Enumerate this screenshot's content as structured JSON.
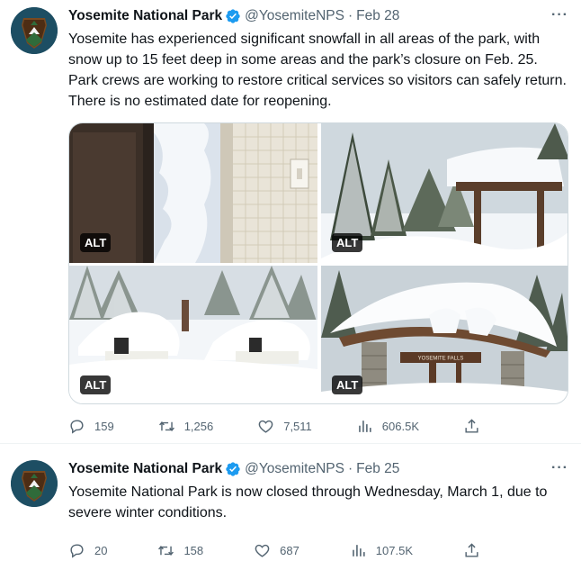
{
  "tweets": [
    {
      "name": "Yosemite National Park",
      "handle": "@YosemiteNPS",
      "separator": "·",
      "date": "Feb 28",
      "more": "···",
      "text": "Yosemite has experienced significant snowfall in all areas of the park, with snow up to 15 feet deep in some areas and the park’s closure on Feb. 25. Park crews are working to restore critical services so visitors can safely return. There is no estimated date for reopening.",
      "media": [
        {
          "alt_badge": "ALT",
          "sign": ""
        },
        {
          "alt_badge": "ALT",
          "sign": ""
        },
        {
          "alt_badge": "ALT",
          "sign": ""
        },
        {
          "alt_badge": "ALT",
          "sign": "YOSEMITE FALLS"
        }
      ],
      "replies": "159",
      "retweets": "1,256",
      "likes": "7,511",
      "views": "606.5K"
    },
    {
      "name": "Yosemite National Park",
      "handle": "@YosemiteNPS",
      "separator": "·",
      "date": "Feb 25",
      "more": "···",
      "text": "Yosemite National Park is now closed through Wednesday, March 1, due to severe winter conditions.",
      "replies": "20",
      "retweets": "158",
      "likes": "687",
      "views": "107.5K"
    }
  ],
  "icons": {
    "verified": "verified-badge-icon",
    "reply": "reply-icon",
    "retweet": "retweet-icon",
    "like": "heart-icon",
    "views": "views-chart-icon",
    "share": "share-icon",
    "avatar": "nps-arrowhead-logo"
  },
  "colors": {
    "verified": "#1d9bf0",
    "secondary_text": "#536471",
    "primary_text": "#0f1419",
    "avatar_bg": "#1d4e63"
  }
}
